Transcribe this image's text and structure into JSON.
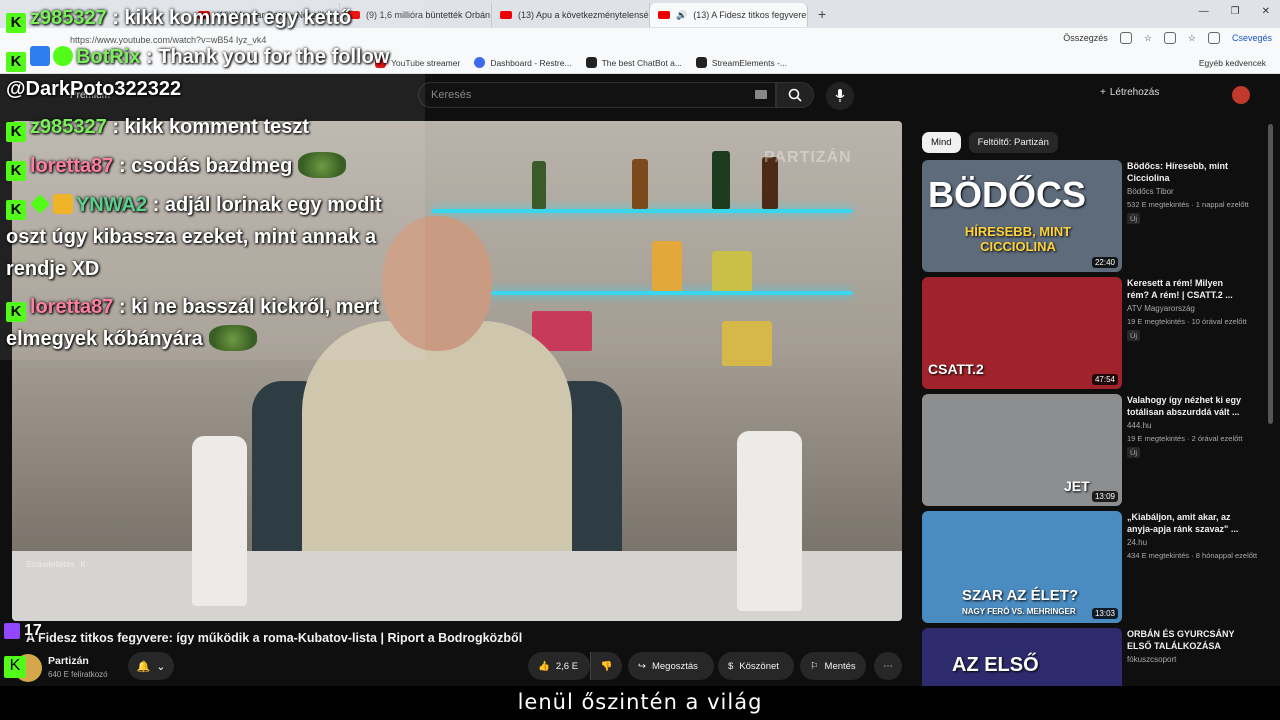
{
  "browser": {
    "tabs": [
      {
        "label": "(12) Magyar Péter - Nézzük csak",
        "active": false
      },
      {
        "label": "(9) 1,6 millióra büntették Orbán Gá",
        "active": false
      },
      {
        "label": "(13) Apu a következménytelenség",
        "active": false
      },
      {
        "label": "(13) A Fidesz titkos fegyvere: í",
        "active": true
      }
    ],
    "url": "https://www.youtube.com/watch?v=wB54 Iyz_vk4",
    "summary_label": "Összegzés",
    "chat_label": "Csevegés",
    "bookmarks": [
      {
        "label": "YouTube streamer",
        "color": "#e00000"
      },
      {
        "label": "Dashboard - Restre...",
        "color": "#3b6cf0"
      },
      {
        "label": "The best ChatBot a...",
        "color": "#222222"
      },
      {
        "label": "StreamElements -...",
        "color": "#222222"
      }
    ],
    "other_bookmarks": "Egyéb kedvencek"
  },
  "youtube": {
    "premium_label": "Premium",
    "search_placeholder": "Keresés",
    "create_label": "Létrehozás",
    "watermark": "PARTIZÁN",
    "paused_label": "Szüneteltetés",
    "paused_key": "K",
    "video_title": "A Fidesz titkos fegyvere: így működik a roma-Kubatov-lista | Riport a Bodrogközből",
    "channel": {
      "name": "Partizán",
      "subs": "640 E feliratkozó"
    },
    "actions": {
      "likes": "2,6 E",
      "share": "Megosztás",
      "thanks": "Köszönet",
      "save": "Mentés"
    },
    "filters": [
      "Mind",
      "Feltöltő: Partizán"
    ],
    "recommendations": [
      {
        "title": "Bödőcs: Híresebb, mint Cicciolina",
        "channel": "Bödőcs Tibor",
        "meta": "532 E megtekintés · 1 nappal ezelőtt",
        "badge": "Új",
        "duration": "22:40",
        "thumb_text": "BÖDŐCS",
        "thumb_sub": "HÍRESEBB, MINT CICCIOLINA",
        "bg": "#5d6b7a"
      },
      {
        "title": "Keresett a rém! Milyen rém? A rém! | CSATT.2 ...",
        "channel": "ATV Magyarország",
        "meta": "19 E megtekintés · 10 órával ezelőtt",
        "badge": "Új",
        "duration": "47:54",
        "thumb_text": "CSATT.2",
        "thumb_sub": "",
        "bg": "#a0232b"
      },
      {
        "title": "Valahogy így nézhet ki egy totálisan abszurddá vált ...",
        "channel": "444.hu",
        "meta": "19 E megtekintés · 2 órával ezelőtt",
        "badge": "Új",
        "duration": "13:09",
        "thumb_text": "JET",
        "thumb_sub": "",
        "bg": "#8c8e90"
      },
      {
        "title": "„Kiabáljon, amit akar, az anyja-apja ránk szavaz\" ...",
        "channel": "24.hu",
        "meta": "434 E megtekintés · 8 hónappal ezelőtt",
        "badge": "",
        "duration": "13:03",
        "thumb_text": "SZAR AZ ÉLET?",
        "thumb_sub": "NAGY FERÓ VS. MEHRINGER",
        "bg": "#4a8cc2"
      },
      {
        "title": "ORBÁN ÉS GYURCSÁNY ELSŐ TALÁLKOZÁSA",
        "channel": "fókuszcsoport",
        "meta": "",
        "badge": "",
        "duration": "",
        "thumb_text": "AZ ELSŐ",
        "thumb_sub": "",
        "bg": "#2d2a6e"
      }
    ]
  },
  "chat": {
    "messages": [
      {
        "user": "z985327",
        "text": ": kikk komment egy kettő",
        "cont": ""
      },
      {
        "user": "BotRix",
        "text": ": Thank you for the follow",
        "cont": "@DarkPoto322322"
      },
      {
        "user": "z985327",
        "text": ": kikk komment teszt",
        "cont": ""
      },
      {
        "user": "loretta87",
        "text": ": csodás bazdmeg",
        "cont": ""
      },
      {
        "user": "YNWA2",
        "text": ": adjál lorinak egy modit",
        "cont": "oszt úgy kibassza ezeket, mint annak a",
        "cont2": "rendje XD"
      },
      {
        "user": "loretta87",
        "text": ": ki ne basszál kickről, mert",
        "cont": "elmegyek kőbányára"
      }
    ],
    "viewer_count": "17"
  },
  "subtitle": "lenül őszintén a világ"
}
